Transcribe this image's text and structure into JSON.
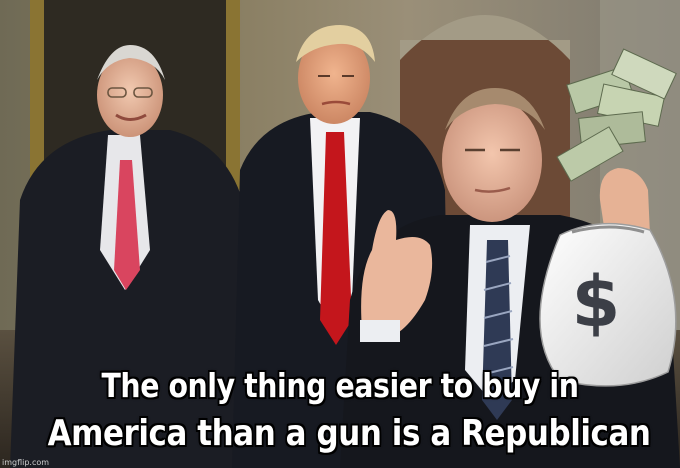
{
  "caption": {
    "line1": "The only thing easier to buy in",
    "line2": "America than a gun is a Republican"
  },
  "watermark": "imgflip.com",
  "bag": {
    "symbol": "$"
  },
  "colors": {
    "caption_text": "#ffffff",
    "caption_outline": "#000000",
    "red_tie": "#c4161c",
    "pink_tie": "#d9455f",
    "suit": "#1b1d24",
    "money_bag": "#eeeeee"
  }
}
